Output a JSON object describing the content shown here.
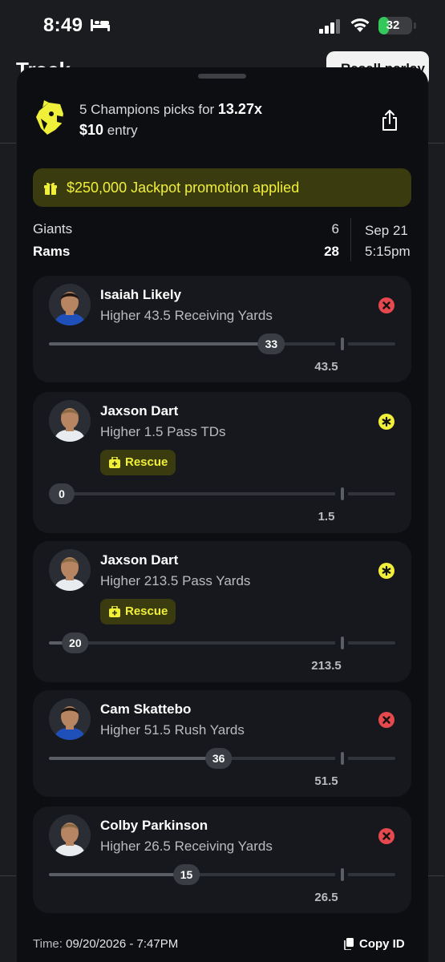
{
  "status_bar": {
    "time": "8:49",
    "battery": "32",
    "battery_level": 0.32
  },
  "background_page": {
    "title": "Track",
    "button_label": "Resell parlay"
  },
  "header": {
    "picks_prefix": "5 Champions picks for ",
    "multiplier": "13.27x",
    "entry_amount": "$10",
    "entry_suffix": " entry"
  },
  "promo": {
    "text": "$250,000 Jackpot promotion applied"
  },
  "game": {
    "team1": "Giants",
    "score1": "6",
    "team2": "Rams",
    "score2": "28",
    "date": "Sep 21",
    "time": "5:15pm"
  },
  "picks": [
    {
      "player": "Isaiah Likely",
      "line": "Higher 43.5 Receiving Yards",
      "current": "33",
      "target": "43.5",
      "progress": 0.76,
      "status": "lost",
      "rescue": false,
      "jersey": "blue"
    },
    {
      "player": "Jaxson Dart",
      "line": "Higher 1.5 Pass TDs",
      "current": "0",
      "target": "1.5",
      "progress": 0.0,
      "status": "rescued",
      "rescue": true,
      "rescue_label": "Rescue",
      "jersey": "white"
    },
    {
      "player": "Jaxson Dart",
      "line": "Higher 213.5 Pass Yards",
      "current": "20",
      "target": "213.5",
      "progress": 0.09,
      "status": "rescued",
      "rescue": true,
      "rescue_label": "Rescue",
      "jersey": "white"
    },
    {
      "player": "Cam Skattebo",
      "line": "Higher 51.5 Rush Yards",
      "current": "36",
      "target": "51.5",
      "progress": 0.58,
      "status": "lost",
      "rescue": false,
      "jersey": "blue"
    },
    {
      "player": "Colby Parkinson",
      "line": "Higher 26.5 Receiving Yards",
      "current": "15",
      "target": "26.5",
      "progress": 0.47,
      "status": "lost",
      "rescue": false,
      "jersey": "white"
    }
  ],
  "footer": {
    "time_label": "Time: ",
    "time_value": "09/20/2026 - 7:47PM",
    "copy_label": "Copy ID"
  },
  "colors": {
    "accent": "#f0f03a",
    "promo_bg": "#3b3b10",
    "lost": "#e5484d",
    "sheet_bg": "#0c0e12",
    "card_bg": "#16181d"
  }
}
